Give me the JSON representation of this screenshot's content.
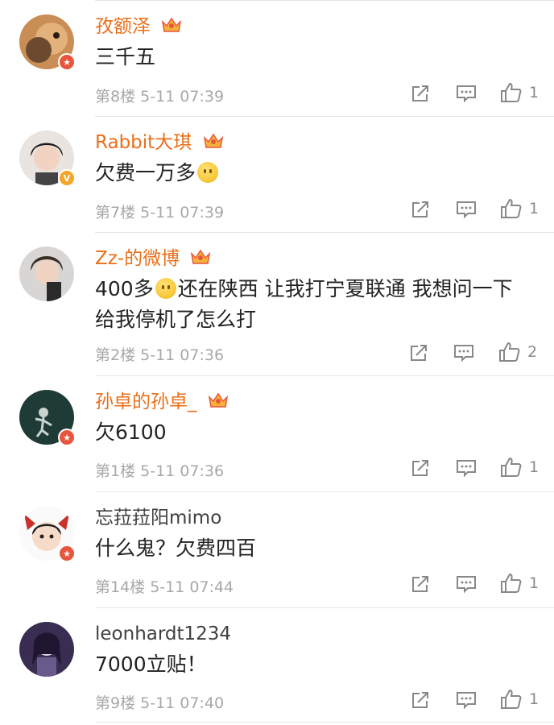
{
  "comments": [
    {
      "username": "孜额泽",
      "vip": true,
      "badge": "red",
      "text": "三千五",
      "floor": "第8楼",
      "time": "5-11 07:39",
      "likes": "1"
    },
    {
      "username": "Rabbit大琪",
      "vip": true,
      "badge": "gold",
      "text_before": "欠费一万多",
      "text_after": "",
      "floor": "第7楼",
      "time": "5-11 07:39",
      "likes": "1"
    },
    {
      "username": "Zz-的微博",
      "vip": true,
      "badge": "none",
      "text_before": "400多",
      "text_after": "还在陕西 让我打宁夏联通 我想问一下给我停机了怎么打",
      "floor": "第2楼",
      "time": "5-11 07:36",
      "likes": "2"
    },
    {
      "username": "孙卓的孙卓_",
      "vip": true,
      "badge": "red",
      "text": "欠6100",
      "floor": "第1楼",
      "time": "5-11 07:36",
      "likes": "1"
    },
    {
      "username": "忘菈菈阳mimo",
      "vip": false,
      "badge": "red",
      "text": "什么鬼？欠费四百",
      "floor": "第14楼",
      "time": "5-11 07:44",
      "likes": "1"
    },
    {
      "username": "leonhardt1234",
      "vip": false,
      "badge": "none",
      "text": "7000立贴！",
      "floor": "第9楼",
      "time": "5-11 07:40",
      "likes": "1"
    }
  ],
  "icons": {
    "repost": "repost-icon",
    "comment": "comment-icon",
    "like": "thumbs-up-icon",
    "crown": "crown-icon"
  },
  "colors": {
    "vip_name": "#ea6f1a",
    "meta": "#a8a8a8",
    "separator": "#e6e6e6"
  }
}
